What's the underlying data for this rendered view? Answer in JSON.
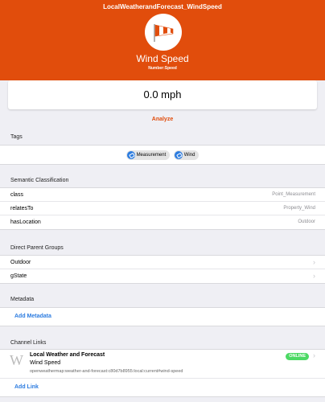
{
  "header": {
    "title": "LocalWeatherandForecast_WindSpeed",
    "name": "Wind Speed",
    "type": "Number:Speed",
    "icon": "windsock-icon",
    "color": "#e14d0c"
  },
  "state": {
    "value": "0.0 mph"
  },
  "analyze_label": "Analyze",
  "tags": {
    "title": "Tags",
    "items": [
      "Measurement",
      "Wind"
    ]
  },
  "semantic": {
    "title": "Semantic Classification",
    "rows": [
      {
        "label": "class",
        "value": "Point_Measurement"
      },
      {
        "label": "relatesTo",
        "value": "Property_Wind"
      },
      {
        "label": "hasLocation",
        "value": "Outdoor"
      }
    ]
  },
  "groups": {
    "title": "Direct Parent Groups",
    "items": [
      "Outdoor",
      "gState"
    ]
  },
  "metadata": {
    "title": "Metadata",
    "add_label": "Add Metadata"
  },
  "channels": {
    "title": "Channel Links",
    "items": [
      {
        "icon_letter": "W",
        "thing": "Local Weather and Forecast",
        "channel": "Wind Speed",
        "uid": "openweathermap:weather-and-forecast:c80d7b8955:local:current#wind-speed",
        "status": "ONLINE"
      }
    ],
    "add_label": "Add Link"
  }
}
